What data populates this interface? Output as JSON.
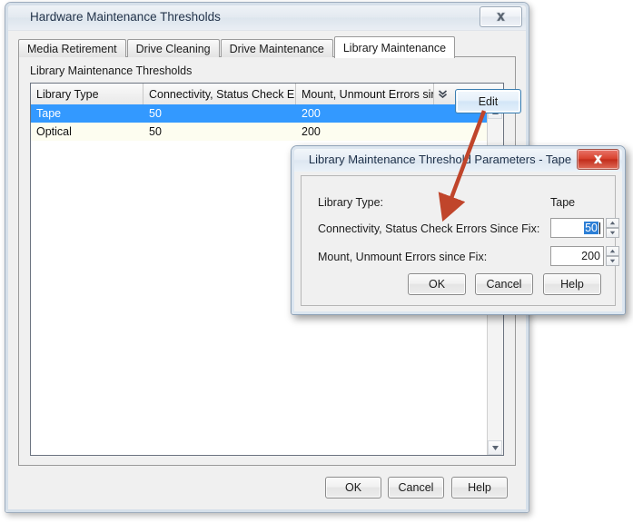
{
  "window": {
    "title": "Hardware Maintenance Thresholds",
    "close_icon": "close-icon",
    "tabs": [
      {
        "label": "Media Retirement",
        "active": false
      },
      {
        "label": "Drive Cleaning",
        "active": false
      },
      {
        "label": "Drive Maintenance",
        "active": false
      },
      {
        "label": "Library Maintenance",
        "active": true
      }
    ],
    "group_label": "Library Maintenance Thresholds",
    "table": {
      "headers": [
        "Library Type",
        "Connectivity, Status Check Er...",
        "Mount, Unmount Errors since Fix"
      ],
      "header_menu_icon": "chevron-double-down-icon",
      "rows": [
        {
          "cells": [
            "Tape",
            "50",
            "200"
          ],
          "selected": true
        },
        {
          "cells": [
            "Optical",
            "50",
            "200"
          ],
          "selected": false
        }
      ],
      "scrollbar": {
        "up_icon": "caret-up-icon",
        "down_icon": "caret-down-icon"
      }
    },
    "edit_button": "Edit",
    "footer": {
      "ok": "OK",
      "cancel": "Cancel",
      "help": "Help"
    }
  },
  "modal": {
    "title": "Library Maintenance Threshold Parameters - Tape",
    "close_icon": "close-icon",
    "fields": [
      {
        "label": "Library Type:",
        "value": "Tape",
        "type": "text"
      },
      {
        "label": "Connectivity, Status Check Errors Since Fix:",
        "value": "50",
        "type": "spinner",
        "selected": true
      },
      {
        "label": "Mount, Unmount Errors since Fix:",
        "value": "200",
        "type": "spinner",
        "selected": false
      }
    ],
    "spinner_up_icon": "caret-up-icon",
    "spinner_down_icon": "caret-down-icon",
    "footer": {
      "ok": "OK",
      "cancel": "Cancel",
      "help": "Help"
    }
  },
  "annotation": {
    "arrow_color": "#c0452b",
    "name": "callout-arrow"
  }
}
